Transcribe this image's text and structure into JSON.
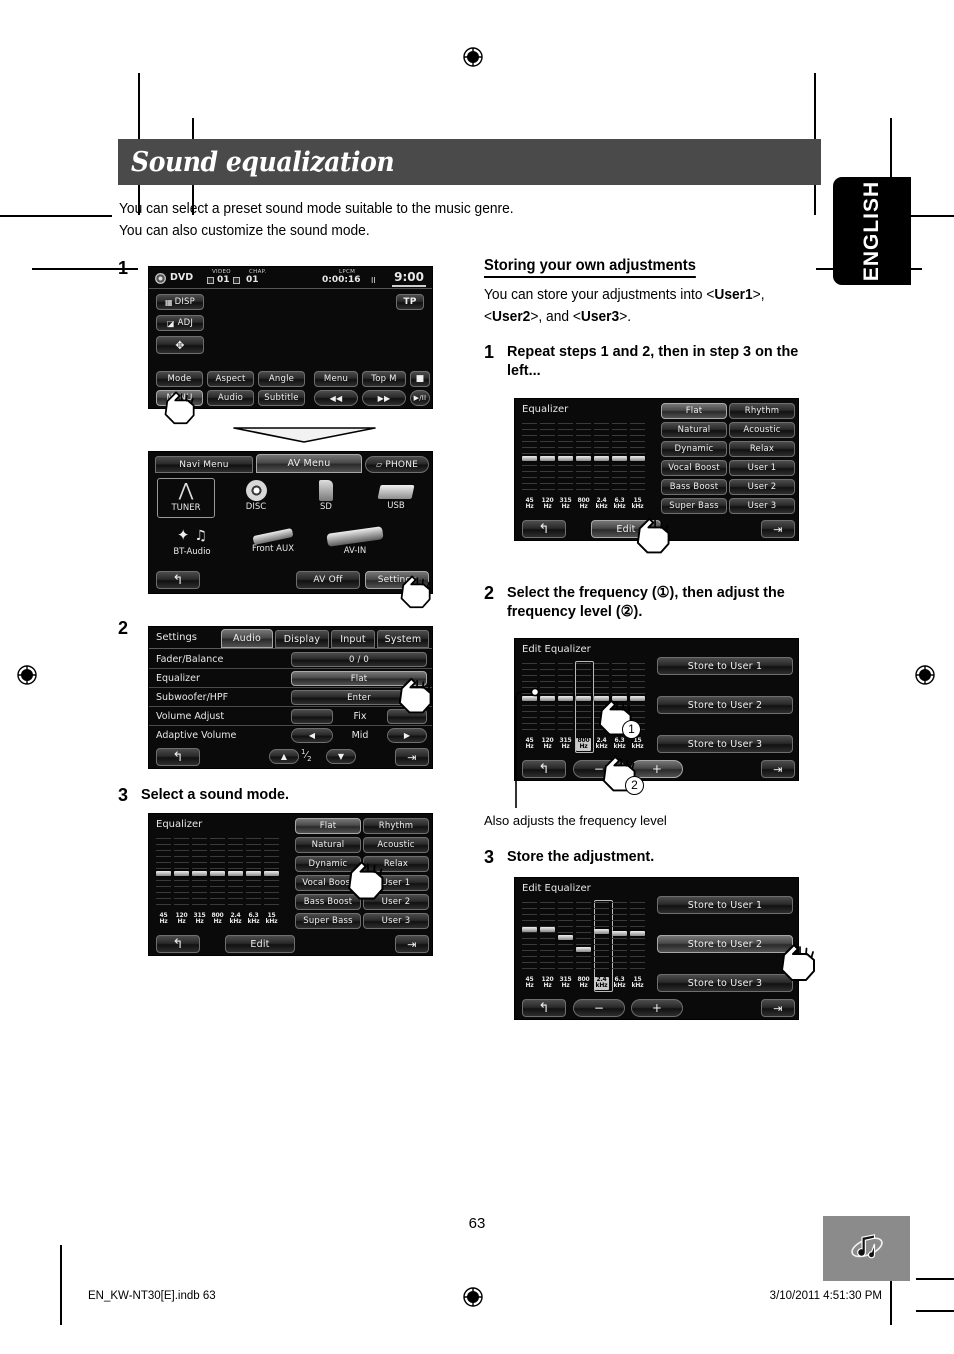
{
  "page": {
    "number": "63",
    "language_tab": "ENGLISH",
    "title": "Sound equalization",
    "intro_line1": "You can select a preset sound mode suitable to the music genre.",
    "intro_line2": "You can also customize the sound mode."
  },
  "footer": {
    "file": "EN_KW-NT30[E].indb   63",
    "timestamp": "3/10/2011   4:51:30 PM",
    "badge_icon": "music-notes-icon"
  },
  "left_column": {
    "steps": [
      {
        "num": "1",
        "text": ""
      },
      {
        "num": "2",
        "text": ""
      },
      {
        "num": "3",
        "text": "Select a sound mode."
      }
    ]
  },
  "right_column": {
    "heading": "Storing your own adjustments",
    "body_pre": "You can store your adjustments into <",
    "user1": "User1",
    "body_mid1": ">, <",
    "user2": "User2",
    "body_mid2": ">, and <",
    "user3": "User3",
    "body_end": ">.",
    "steps": [
      {
        "num": "1",
        "text": "Repeat steps 1 and 2, then in step 3 on the left..."
      },
      {
        "num": "2",
        "text": "Select the frequency (①), then adjust the frequency level (②)."
      },
      {
        "num": "3",
        "text": "Store the adjustment."
      }
    ],
    "leader_note": "Also adjusts the frequency level",
    "callout_1": "①",
    "callout_2": "②"
  },
  "screens": {
    "dvd_playback": {
      "source": "DVD",
      "video_label": "VIDEO",
      "video_value": "01",
      "chapter_label": "CHAP.",
      "chapter_value": "01",
      "format_label": "LPCM",
      "time": "0:00:16",
      "clock": "9:00",
      "tp_badge": "TP",
      "left_buttons": [
        "DISP",
        "ADJ"
      ],
      "disp_icon": "grid-icon",
      "adj_icon": "adjust-icon",
      "cursor_icon": "four-way-cursor-icon",
      "row1": [
        "Mode",
        "Aspect",
        "Angle",
        "Menu",
        "Top M"
      ],
      "row1_icon": "stop-square-icon",
      "row2": [
        "MENU",
        "Audio",
        "Subtitle"
      ],
      "transport": [
        "prev-track-icon",
        "next-track-icon",
        "play-pause-icon"
      ],
      "transport_labels": [
        "◀◀",
        "▶▶",
        "▶/II"
      ]
    },
    "av_menu": {
      "tabs": [
        "Navi Menu",
        "AV Menu"
      ],
      "phone_button": "PHONE",
      "phone_icon": "phone-icon",
      "sources_row1": [
        {
          "label": "TUNER",
          "icon": "antenna-icon",
          "selected": true
        },
        {
          "label": "DISC",
          "icon": "disc-icon",
          "selected": false
        },
        {
          "label": "SD",
          "icon": "sd-card-icon",
          "selected": false
        },
        {
          "label": "USB",
          "icon": "usb-stick-icon",
          "selected": false
        }
      ],
      "sources_row2": [
        {
          "label": "BT-Audio",
          "icon": "bluetooth-audio-icon"
        },
        {
          "label": "Front AUX",
          "icon": "aux-plug-icon"
        },
        {
          "label": "AV-IN",
          "icon": "rca-cables-icon"
        }
      ],
      "back_icon": "back-arrow-icon",
      "av_off": "AV Off",
      "settings": "Settings"
    },
    "settings_audio": {
      "title": "Settings",
      "tabs": [
        "Audio",
        "Display",
        "Input",
        "System"
      ],
      "active_tab": "Audio",
      "rows": [
        {
          "label": "Fader/Balance",
          "value": "0 / 0"
        },
        {
          "label": "Equalizer",
          "value": "Flat"
        },
        {
          "label": "Subwoofer/HPF",
          "value": "Enter"
        },
        {
          "label": "Volume Adjust",
          "value": "Fix"
        },
        {
          "label": "Adaptive Volume",
          "value": "Mid"
        }
      ],
      "page_indicator": "1/2",
      "page_current": "1",
      "page_total": "2",
      "back_icon": "back-arrow-icon",
      "up_icon": "up-arrow-icon",
      "down_icon": "down-arrow-icon",
      "exit_icon": "exit-icon",
      "left_icon": "left-arrow-icon",
      "right_icon": "right-arrow-icon"
    },
    "equalizer": {
      "title": "Equalizer",
      "presets_col1": [
        "Flat",
        "Natural",
        "Dynamic",
        "Vocal Boost",
        "Bass Boost",
        "Super Bass"
      ],
      "presets_col2": [
        "Rhythm",
        "Acoustic",
        "Relax",
        "User 1",
        "User 2",
        "User 3"
      ],
      "selected_preset": "Flat",
      "bands": [
        "45\nHz",
        "120\nHz",
        "315\nHz",
        "800\nHz",
        "2.4\nkHz",
        "6.3\nkHz",
        "15\nkHz"
      ],
      "band_labels_top": [
        "45",
        "120",
        "315",
        "800",
        "2.4",
        "6.3",
        "15"
      ],
      "band_labels_bottom": [
        "Hz",
        "Hz",
        "Hz",
        "Hz",
        "kHz",
        "kHz",
        "kHz"
      ],
      "levels": [
        0,
        0,
        0,
        0,
        0,
        0,
        0
      ],
      "edit_button": "Edit",
      "back_icon": "back-arrow-icon",
      "exit_icon": "exit-icon"
    },
    "edit_equalizer_step2": {
      "title": "Edit Equalizer",
      "band_labels_top": [
        "45",
        "120",
        "315",
        "800",
        "2.4",
        "6.3",
        "15"
      ],
      "band_labels_bottom": [
        "Hz",
        "Hz",
        "Hz",
        "Hz",
        "kHz",
        "kHz",
        "kHz"
      ],
      "levels": [
        0,
        0,
        0,
        0,
        0,
        0,
        0
      ],
      "selected_band_index": 3,
      "selected_band": "800 Hz",
      "store_buttons": [
        "Store to User 1",
        "Store to User 2",
        "Store to User 3"
      ],
      "minus_label": "−",
      "plus_label": "+",
      "back_icon": "back-arrow-icon",
      "exit_icon": "exit-icon"
    },
    "edit_equalizer_step3": {
      "title": "Edit Equalizer",
      "band_labels_top": [
        "45",
        "120",
        "315",
        "800",
        "2.4",
        "6.3",
        "15"
      ],
      "band_labels_bottom": [
        "Hz",
        "Hz",
        "Hz",
        "Hz",
        "kHz",
        "kHz",
        "kHz"
      ],
      "levels": [
        2,
        2,
        0,
        -2,
        2,
        1,
        1
      ],
      "selected_band_index": 4,
      "selected_band": "2.4 kHz",
      "store_buttons": [
        "Store to User 1",
        "Store to User 2",
        "Store to User 3"
      ],
      "minus_label": "−",
      "plus_label": "+",
      "back_icon": "back-arrow-icon",
      "exit_icon": "exit-icon"
    }
  }
}
